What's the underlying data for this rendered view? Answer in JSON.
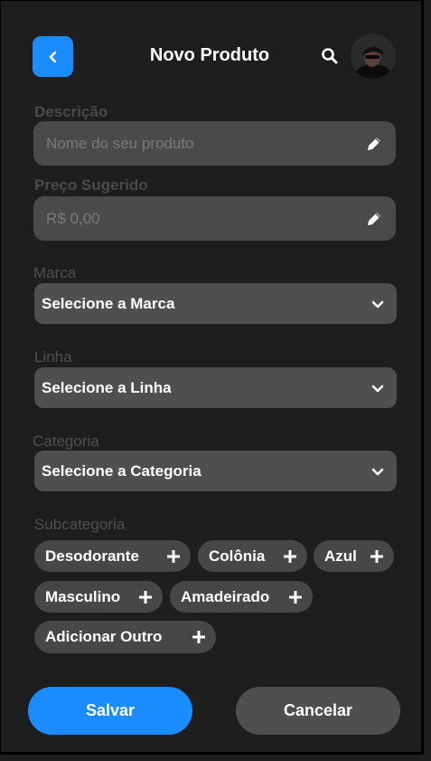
{
  "header": {
    "title": "Novo Produto"
  },
  "form": {
    "description": {
      "label": "Descrição",
      "placeholder": "Nome do seu produto"
    },
    "price": {
      "label": "Preço Sugerido",
      "placeholder": "R$ 0,00"
    },
    "brand": {
      "label": "Marca",
      "value": "Selecione a Marca"
    },
    "line": {
      "label": "Linha",
      "value": "Selecione a Linha"
    },
    "category": {
      "label": "Categoria",
      "value": "Selecione a Categoria"
    },
    "subcategory": {
      "label": "Subcategoria",
      "chips": [
        "Desodorante",
        "Colônia",
        "Azul",
        "Masculino",
        "Amadeirado",
        "Adicionar Outro"
      ]
    }
  },
  "actions": {
    "save_label": "Salvar",
    "cancel_label": "Cancelar"
  },
  "colors": {
    "accent": "#1a8cff",
    "background": "#1e1e1e",
    "field": "#4a4a4a"
  },
  "icons": [
    "chevron-left-icon",
    "search-icon",
    "pencil-icon",
    "chevron-down-icon",
    "plus-icon"
  ]
}
